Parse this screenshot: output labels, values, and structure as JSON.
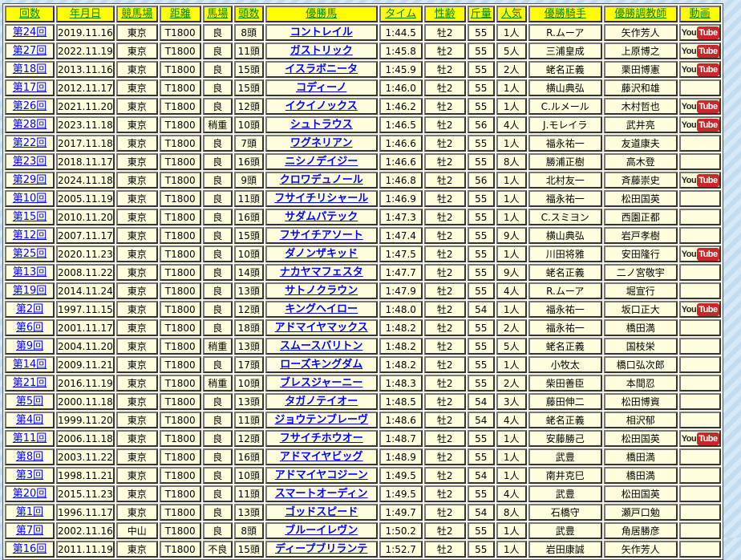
{
  "headers": [
    "回数",
    "年月日",
    "競馬場",
    "距離",
    "馬場",
    "頭数",
    "優勝馬",
    "タイム",
    "性齢",
    "斤量",
    "人気",
    "優勝騎手",
    "優勝調教師",
    "動画"
  ],
  "youtube": {
    "you": "You",
    "tube": "Tube"
  },
  "rows": [
    [
      "第24回",
      "2019.11.16",
      "東京",
      "T1800",
      "良",
      "8頭",
      "コントレイル",
      "1:44.5",
      "牡2",
      "55",
      "1人",
      "R.ムーア",
      "矢作芳人",
      true
    ],
    [
      "第27回",
      "2022.11.19",
      "東京",
      "T1800",
      "良",
      "11頭",
      "ガストリック",
      "1:45.8",
      "牡2",
      "55",
      "5人",
      "三浦皇成",
      "上原博之",
      true
    ],
    [
      "第18回",
      "2013.11.16",
      "東京",
      "T1800",
      "良",
      "15頭",
      "イスラボニータ",
      "1:45.9",
      "牡2",
      "55",
      "2人",
      "蛯名正義",
      "栗田博憲",
      true
    ],
    [
      "第17回",
      "2012.11.17",
      "東京",
      "T1800",
      "良",
      "15頭",
      "コディーノ",
      "1:46.0",
      "牡2",
      "55",
      "1人",
      "横山典弘",
      "藤沢和雄",
      false
    ],
    [
      "第26回",
      "2021.11.20",
      "東京",
      "T1800",
      "良",
      "12頭",
      "イクイノックス",
      "1:46.2",
      "牡2",
      "55",
      "1人",
      "C.ルメール",
      "木村哲也",
      true
    ],
    [
      "第28回",
      "2023.11.18",
      "東京",
      "T1800",
      "稍重",
      "10頭",
      "シュトラウス",
      "1:46.5",
      "牡2",
      "56",
      "4人",
      "J.モレイラ",
      "武井亮",
      true
    ],
    [
      "第22回",
      "2017.11.18",
      "東京",
      "T1800",
      "良",
      "7頭",
      "ワグネリアン",
      "1:46.6",
      "牡2",
      "55",
      "1人",
      "福永祐一",
      "友道康夫",
      false
    ],
    [
      "第23回",
      "2018.11.17",
      "東京",
      "T1800",
      "良",
      "16頭",
      "ニシノデイジー",
      "1:46.6",
      "牡2",
      "55",
      "8人",
      "勝浦正樹",
      "高木登",
      false
    ],
    [
      "第29回",
      "2024.11.18",
      "東京",
      "T1800",
      "良",
      "9頭",
      "クロワデュノール",
      "1:46.8",
      "牡2",
      "56",
      "1人",
      "北村友一",
      "斉藤崇史",
      true
    ],
    [
      "第10回",
      "2005.11.19",
      "東京",
      "T1800",
      "良",
      "11頭",
      "フサイチリシャール",
      "1:46.9",
      "牡2",
      "55",
      "1人",
      "福永祐一",
      "松田国英",
      false
    ],
    [
      "第15回",
      "2010.11.20",
      "東京",
      "T1800",
      "良",
      "16頭",
      "サダムパテック",
      "1:47.3",
      "牡2",
      "55",
      "1人",
      "C.スミヨン",
      "西園正都",
      false
    ],
    [
      "第12回",
      "2007.11.17",
      "東京",
      "T1800",
      "良",
      "15頭",
      "フサイチアソート",
      "1:47.4",
      "牡2",
      "55",
      "9人",
      "横山典弘",
      "岩戸孝樹",
      false
    ],
    [
      "第25回",
      "2020.11.23",
      "東京",
      "T1800",
      "良",
      "10頭",
      "ダノンザキッド",
      "1:47.5",
      "牡2",
      "55",
      "1人",
      "川田将雅",
      "安田隆行",
      true
    ],
    [
      "第13回",
      "2008.11.22",
      "東京",
      "T1800",
      "良",
      "14頭",
      "ナカヤマフェスタ",
      "1:47.7",
      "牡2",
      "55",
      "9人",
      "蛯名正義",
      "二ノ宮敬宇",
      false
    ],
    [
      "第19回",
      "2014.11.24",
      "東京",
      "T1800",
      "良",
      "13頭",
      "サトノクラウン",
      "1:47.9",
      "牡2",
      "55",
      "4人",
      "R.ムーア",
      "堀宣行",
      false
    ],
    [
      "第2回",
      "1997.11.15",
      "東京",
      "T1800",
      "良",
      "12頭",
      "キングヘイロー",
      "1:48.0",
      "牡2",
      "54",
      "1人",
      "福永祐一",
      "坂口正大",
      true
    ],
    [
      "第6回",
      "2001.11.17",
      "東京",
      "T1800",
      "良",
      "18頭",
      "アドマイヤマックス",
      "1:48.2",
      "牡2",
      "55",
      "2人",
      "福永祐一",
      "橋田満",
      false
    ],
    [
      "第9回",
      "2004.11.20",
      "東京",
      "T1800",
      "稍重",
      "13頭",
      "スムースバリトン",
      "1:48.2",
      "牡2",
      "55",
      "5人",
      "蛯名正義",
      "国枝栄",
      false
    ],
    [
      "第14回",
      "2009.11.21",
      "東京",
      "T1800",
      "良",
      "17頭",
      "ローズキングダム",
      "1:48.2",
      "牡2",
      "55",
      "1人",
      "小牧太",
      "橋口弘次郎",
      false
    ],
    [
      "第21回",
      "2016.11.19",
      "東京",
      "T1800",
      "稍重",
      "10頭",
      "ブレスジャーニー",
      "1:48.3",
      "牡2",
      "55",
      "2人",
      "柴田善臣",
      "本間忍",
      false
    ],
    [
      "第5回",
      "2000.11.18",
      "東京",
      "T1800",
      "良",
      "13頭",
      "タガノテイオー",
      "1:48.5",
      "牡2",
      "54",
      "3人",
      "藤田伸二",
      "松田博資",
      false
    ],
    [
      "第4回",
      "1999.11.20",
      "東京",
      "T1800",
      "良",
      "11頭",
      "ジョウテンブレーヴ",
      "1:48.6",
      "牡2",
      "54",
      "4人",
      "蛯名正義",
      "相沢郁",
      false
    ],
    [
      "第11回",
      "2006.11.18",
      "東京",
      "T1800",
      "良",
      "12頭",
      "フサイチホウオー",
      "1:48.7",
      "牡2",
      "55",
      "1人",
      "安藤勝己",
      "松田国英",
      true
    ],
    [
      "第8回",
      "2003.11.22",
      "東京",
      "T1800",
      "良",
      "16頭",
      "アドマイヤビッグ",
      "1:48.9",
      "牡2",
      "55",
      "1人",
      "武豊",
      "橋田満",
      false
    ],
    [
      "第3回",
      "1998.11.21",
      "東京",
      "T1800",
      "良",
      "10頭",
      "アドマイヤコジーン",
      "1:49.5",
      "牡2",
      "54",
      "1人",
      "南井克巳",
      "橋田満",
      false
    ],
    [
      "第20回",
      "2015.11.23",
      "東京",
      "T1800",
      "良",
      "11頭",
      "スマートオーディン",
      "1:49.5",
      "牡2",
      "55",
      "4人",
      "武豊",
      "松田国英",
      false
    ],
    [
      "第1回",
      "1996.11.17",
      "東京",
      "T1800",
      "良",
      "13頭",
      "ゴッドスピード",
      "1:49.7",
      "牡2",
      "54",
      "8人",
      "石橋守",
      "瀬戸口勉",
      false
    ],
    [
      "第7回",
      "2002.11.16",
      "中山",
      "T1800",
      "良",
      "8頭",
      "ブルーイレヴン",
      "1:50.2",
      "牡2",
      "55",
      "1人",
      "武豊",
      "角居勝彦",
      false
    ],
    [
      "第16回",
      "2011.11.19",
      "東京",
      "T1800",
      "不良",
      "15頭",
      "ディープブリランテ",
      "1:52.7",
      "牡2",
      "55",
      "1人",
      "岩田康誠",
      "矢作芳人",
      false
    ]
  ]
}
